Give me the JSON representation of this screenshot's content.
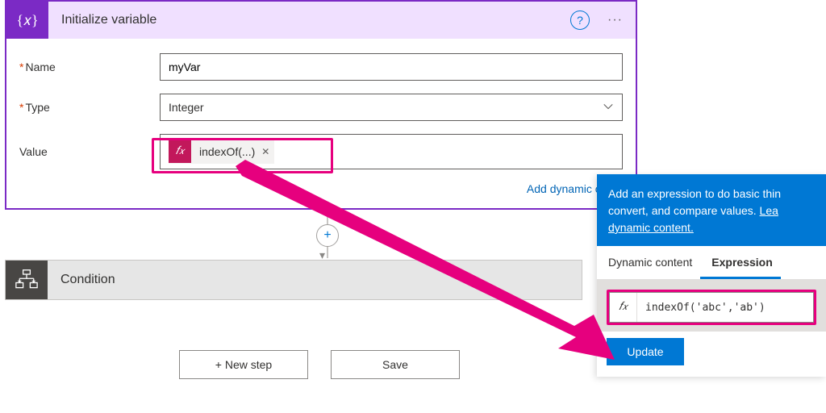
{
  "init_card": {
    "title": "Initialize variable",
    "name_label": "Name",
    "name_value": "myVar",
    "type_label": "Type",
    "type_value": "Integer",
    "value_label": "Value",
    "token_text": "indexOf(...)",
    "dynamic_link": "Add dynamic conte"
  },
  "condition": {
    "title": "Condition"
  },
  "buttons": {
    "new_step": "+ New step",
    "save": "Save"
  },
  "popover": {
    "header_text": "Add an expression to do basic thin convert, and compare values. ",
    "header_link": "Lea dynamic content.",
    "tab_dynamic": "Dynamic content",
    "tab_expression": "Expression",
    "expression_value": "indexOf('abc','ab')",
    "update": "Update"
  }
}
